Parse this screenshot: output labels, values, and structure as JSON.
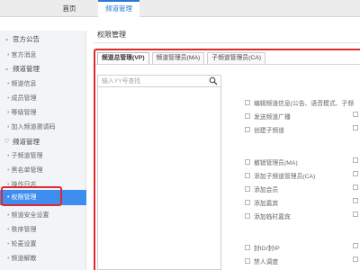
{
  "topnav": {
    "home": "首页",
    "channel": "频道管理"
  },
  "sidebar": {
    "groups": [
      {
        "label": "官方公告",
        "icon": "chevron-down-icon",
        "items": [
          {
            "label": "官方消息"
          }
        ]
      },
      {
        "label": "频道管理",
        "icon": "chevron-down-icon",
        "items": [
          {
            "label": "频道信息"
          },
          {
            "label": "成员管理"
          },
          {
            "label": "等级管理"
          },
          {
            "label": "加入频道邀请码"
          }
        ]
      },
      {
        "label": "频道管理",
        "icon": "heart-icon",
        "items": [
          {
            "label": "子频道管理"
          },
          {
            "label": "黑名单管理"
          },
          {
            "label": "操作日志"
          },
          {
            "label": "权限管理",
            "active": true
          },
          {
            "label": "频道安全设置"
          },
          {
            "label": "秩序管理"
          },
          {
            "label": "轮麦设置"
          },
          {
            "label": "频道解散"
          }
        ]
      }
    ]
  },
  "main": {
    "title": "权限管理",
    "tabs": [
      {
        "label": "频道总管理(VP)",
        "active": true
      },
      {
        "label": "频道管理员(MA)"
      },
      {
        "label": "子频道管理员(CA)"
      }
    ],
    "search": {
      "placeholder": "输入YY号查找"
    },
    "permissions": [
      {
        "label": "编辑频道信息(公告、语音模式、子频"
      },
      {
        "label": "发送频道广播"
      },
      {
        "label": "创建子频道"
      },
      {
        "label": "撤销管理员(MA)"
      },
      {
        "label": "添加子频道管理员(CA)"
      },
      {
        "label": "添加会员"
      },
      {
        "label": "添加嘉宾"
      },
      {
        "label": "添加临时嘉宾"
      },
      {
        "label": "封ID/封IP"
      },
      {
        "label": "禁人调度"
      }
    ]
  },
  "colors": {
    "accent": "#3e8ef0",
    "highlight": "#e0282e",
    "tab_active_text": "#2a7bd0"
  }
}
